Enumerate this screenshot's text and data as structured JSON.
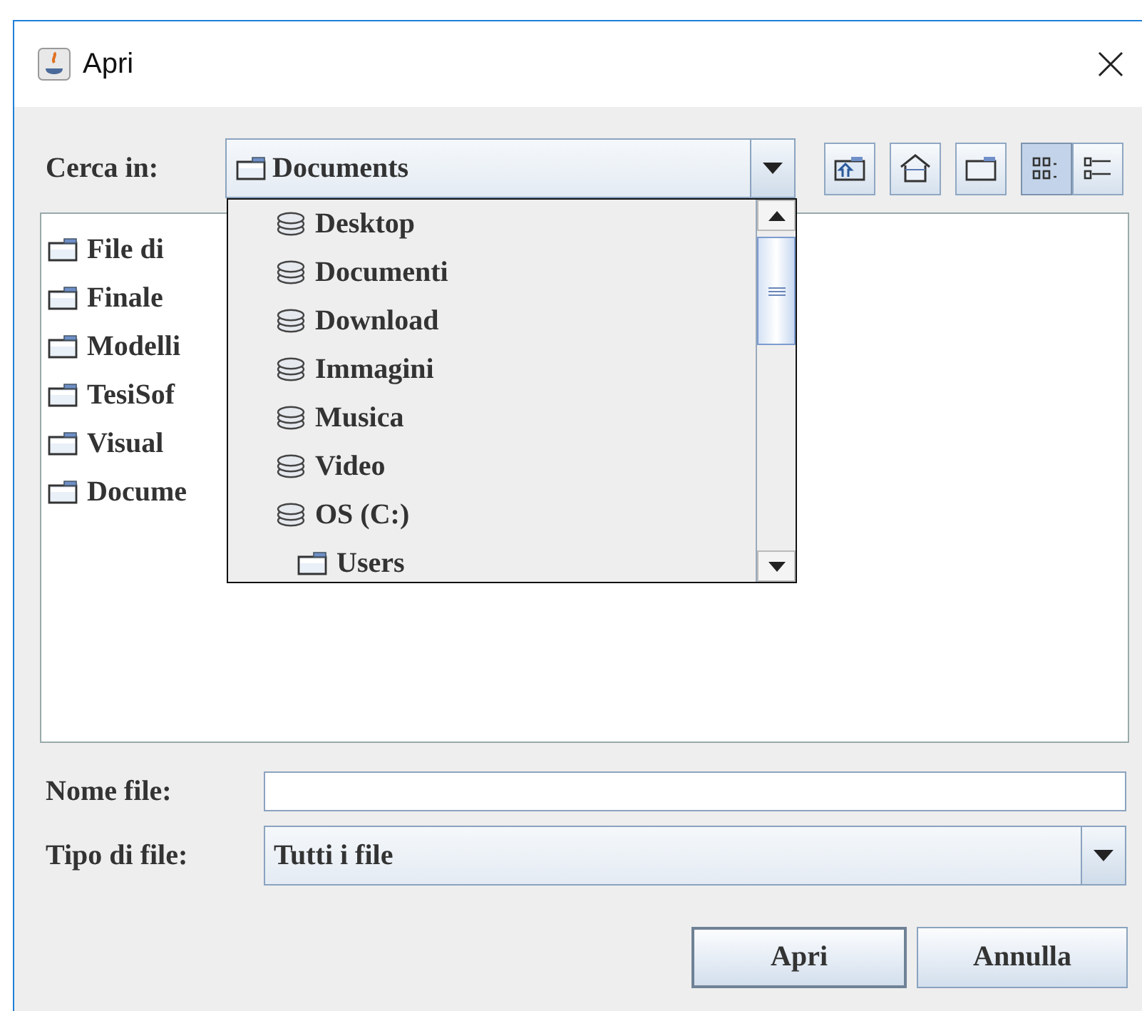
{
  "window": {
    "title": "Apri"
  },
  "look_in": {
    "label": "Cerca in:",
    "value": "Documents",
    "expanded": true,
    "popup_items": [
      {
        "label": "Desktop",
        "kind": "drive"
      },
      {
        "label": "Documenti",
        "kind": "drive"
      },
      {
        "label": "Download",
        "kind": "drive"
      },
      {
        "label": "Immagini",
        "kind": "drive"
      },
      {
        "label": "Musica",
        "kind": "drive"
      },
      {
        "label": "Video",
        "kind": "drive"
      },
      {
        "label": "OS (C:)",
        "kind": "drive",
        "children": [
          {
            "label": "Users",
            "kind": "folder"
          }
        ]
      }
    ]
  },
  "view_buttons": [
    {
      "selected": true
    },
    {
      "selected": false
    }
  ],
  "files": [
    {
      "name": "File di"
    },
    {
      "name": "Finale"
    },
    {
      "name": "Modelli"
    },
    {
      "name": "TesiSof"
    },
    {
      "name": "Visual"
    },
    {
      "name": "Docume"
    }
  ],
  "file_name": {
    "label": "Nome file:"
  },
  "file_type": {
    "label": "Tipo di file:",
    "value": "Tutti i file"
  },
  "buttons": [
    {
      "label": "Apri",
      "default": true
    },
    {
      "label": "Annulla",
      "default": false
    }
  ]
}
